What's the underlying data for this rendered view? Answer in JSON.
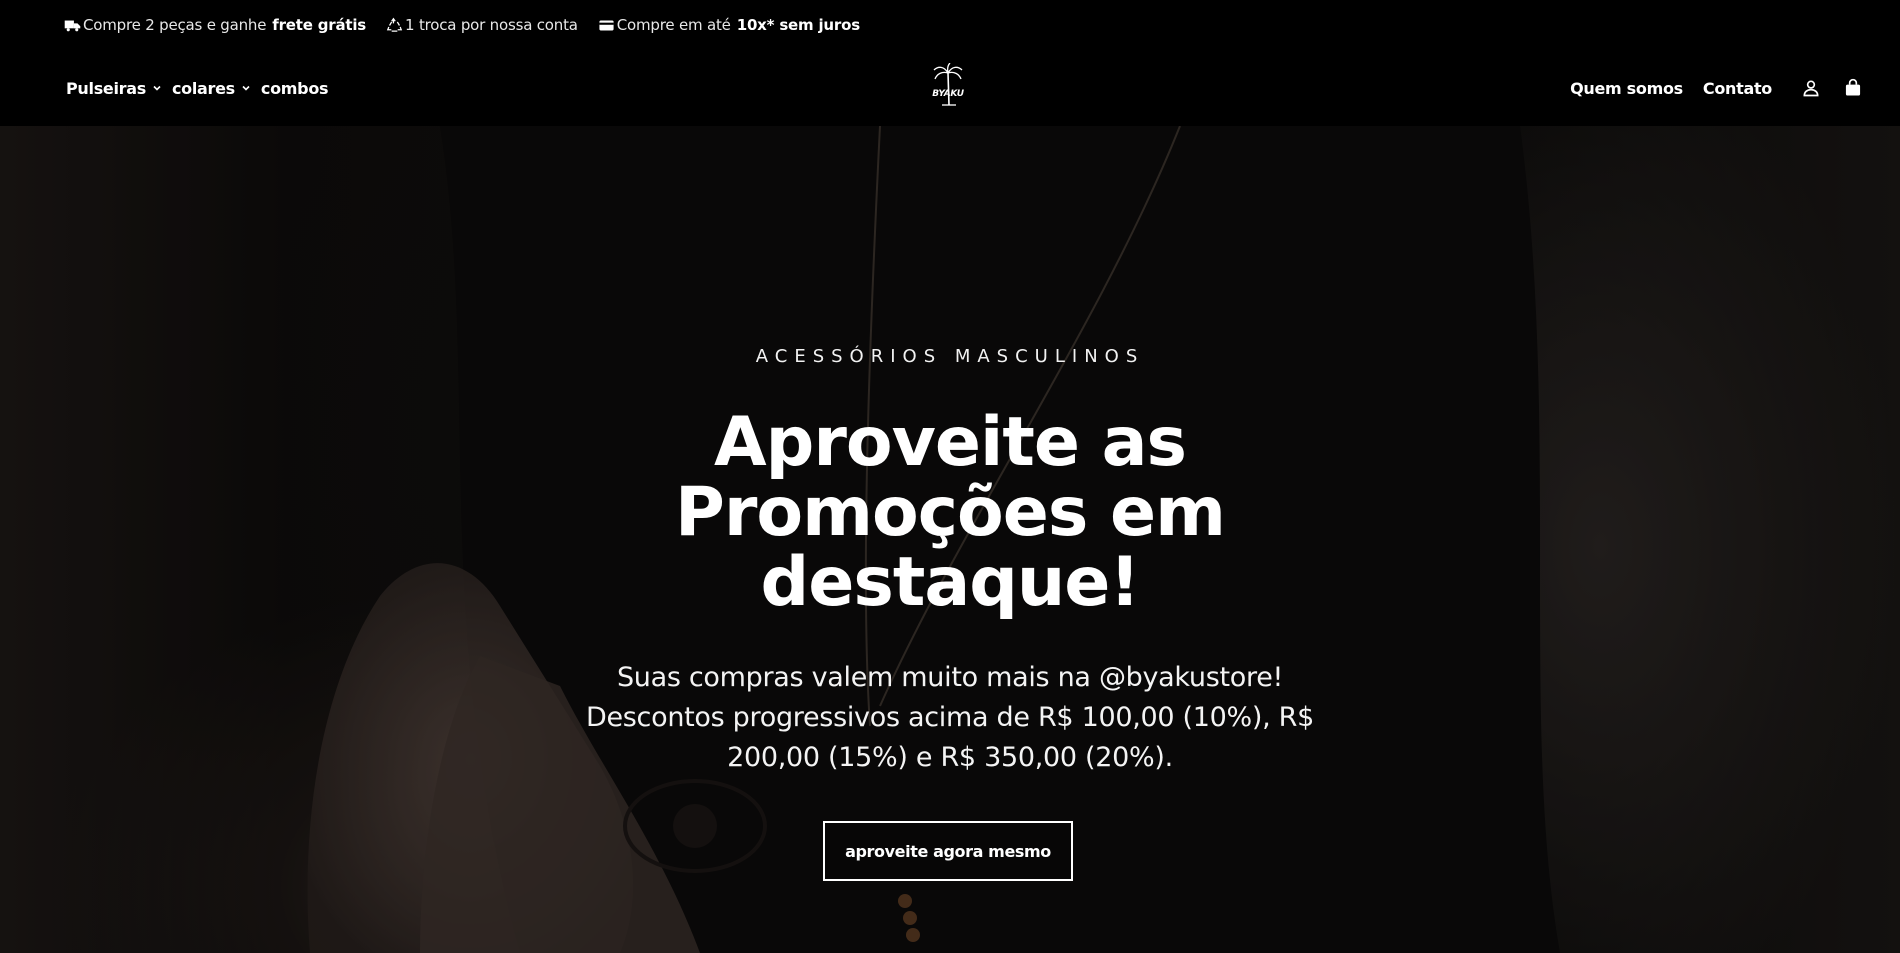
{
  "announcement": {
    "shipping": {
      "icon": "truck-icon",
      "prefix": "Compre 2 peças e ganhe",
      "bold": "frete grátis"
    },
    "exchange": {
      "icon": "recycle-icon",
      "text": "1 troca por nossa conta"
    },
    "installments": {
      "icon": "credit-card-icon",
      "prefix": "Compre em até",
      "bold": "10x* sem juros"
    }
  },
  "nav": {
    "left": [
      {
        "label": "Pulseiras",
        "has_dropdown": true
      },
      {
        "label": "colares",
        "has_dropdown": true
      },
      {
        "label": "combos",
        "has_dropdown": false
      }
    ],
    "logo_text": "BYAKU",
    "right": [
      {
        "label": "Quem somos"
      },
      {
        "label": "Contato"
      }
    ],
    "account_icon": "user-icon",
    "cart_icon": "shopping-bag-icon"
  },
  "hero": {
    "eyebrow": "ACESSÓRIOS MASCULINOS",
    "headline": "Aproveite as Promoções em destaque!",
    "subtext": "Suas compras valem muito mais na @byakustore! Descontos progressivos acima de R$ 100,00 (10%), R$ 200,00 (15%) e R$ 350,00 (20%).",
    "cta_label": "aproveite agora mesmo"
  },
  "colors": {
    "background": "#000000",
    "text": "#ffffff"
  }
}
